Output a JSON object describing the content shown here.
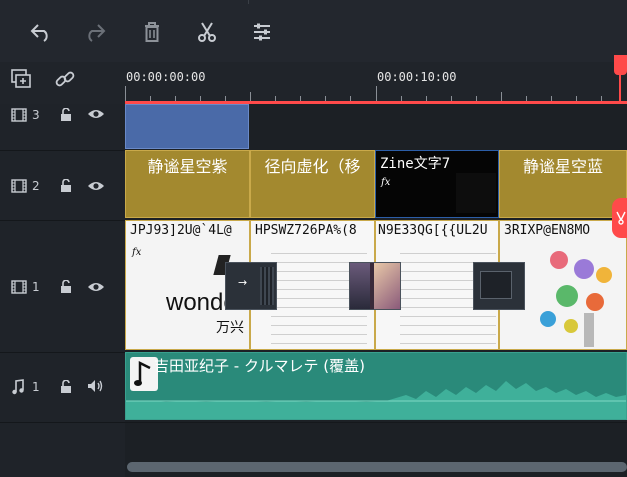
{
  "toolbar": {
    "undo_icon": "undo-icon",
    "redo_icon": "redo-icon",
    "delete_icon": "trash-icon",
    "cut_icon": "scissors-icon",
    "adjust_icon": "sliders-icon"
  },
  "timeline": {
    "add_track_icon": "add-track-icon",
    "link_icon": "link-icon",
    "time_start": "00:00:00:00",
    "time_mid": "00:00:10:00"
  },
  "tracks": {
    "pip3": {
      "number": "3"
    },
    "pip2": {
      "number": "2",
      "clips": [
        "静谧星空紫",
        "径向虚化（移",
        "Zine文字7",
        "静谧星空蓝"
      ],
      "fx": "fx"
    },
    "video1": {
      "number": "1",
      "clips": [
        "JPJ93]2U@`4L@",
        "HPSWZ726PA%(8",
        "N9E33QG[{{UL2U",
        "3RIXP@EN8MO"
      ],
      "fx": "fx",
      "logo_text_1": "wonde",
      "logo_text_2": "万兴",
      "transition_arrow": "→"
    },
    "audio1": {
      "number": "1",
      "clip_title": "吉田亚纪子 - クルマレテ (覆盖)"
    }
  },
  "colors": {
    "playhead": "#ff4a4a",
    "gold_clip": "#a3892f",
    "blue_clip": "#4a6aa8",
    "audio_clip": "#2a8a7a"
  }
}
